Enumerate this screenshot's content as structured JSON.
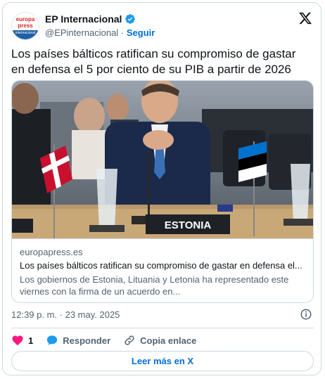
{
  "author": {
    "display_name": "EP Internacional",
    "handle": "@EPinternacional",
    "separator": "·",
    "follow_label": "Seguir",
    "avatar": {
      "line1": "europa",
      "line2": "press",
      "band": "internacional"
    }
  },
  "tweet": {
    "text": "Los países bálticos ratifican su compromiso de gastar en defensa el 5 por ciento de su PIB a partir de 2026"
  },
  "media": {
    "nameplate": "ESTONIA"
  },
  "link_card": {
    "domain": "europapress.es",
    "title": "Los países bálticos ratifican su compromiso de gastar en defensa el...",
    "description": "Los gobiernos de Estonia, Lituania y Letonia ha representado este viernes con la firma de un acuerdo en..."
  },
  "meta": {
    "timestamp": "12:39 p. m. · 23 may. 2025"
  },
  "actions": {
    "like_count": "1",
    "reply_label": "Responder",
    "copy_label": "Copia enlace"
  },
  "read_more_label": "Leer más en X",
  "colors": {
    "accent": "#006fd6",
    "verified": "#1d9bf0",
    "like": "#f91880",
    "border": "#cfd9de",
    "muted": "#536471"
  }
}
